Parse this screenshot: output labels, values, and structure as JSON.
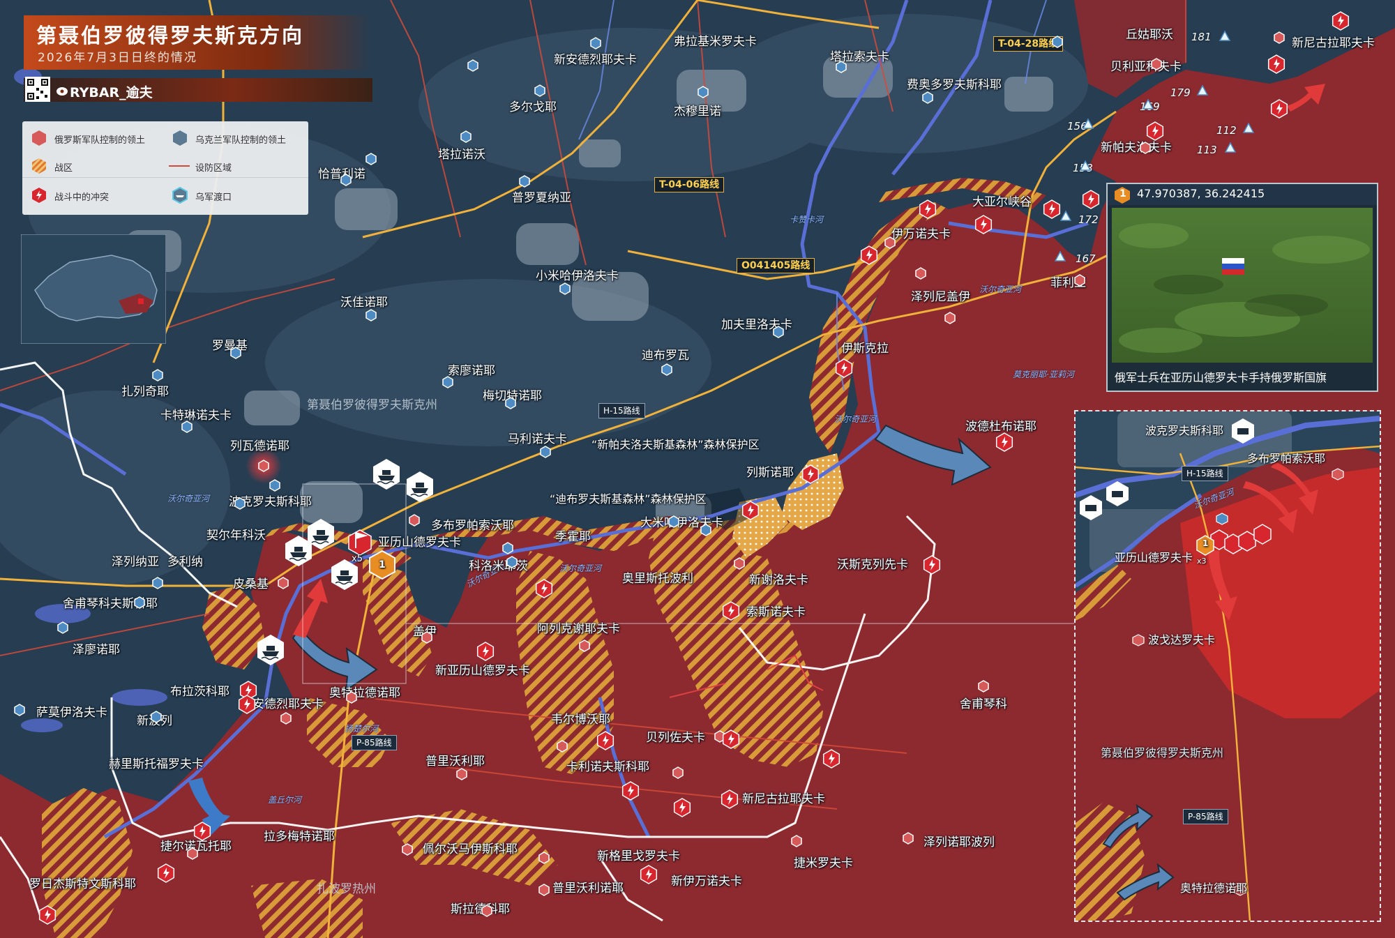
{
  "header": {
    "title": "第聂伯罗彼得罗夫斯克方向",
    "subtitle": "2026年7月3日日终的情况",
    "brand": "RYBAR_逾夫"
  },
  "legend": {
    "items": [
      {
        "label": "俄罗斯军队控制的领土",
        "icon": "russian-territory-icon"
      },
      {
        "label": "乌克兰军队控制的领土",
        "icon": "ukrainian-territory-icon"
      },
      {
        "label": "战区",
        "icon": "combat-zone-icon"
      },
      {
        "label": "设防区域",
        "icon": "fortified-line-icon"
      },
      {
        "label": "战斗中的冲突",
        "icon": "clash-icon"
      },
      {
        "label": "乌军渡口",
        "icon": "crossing-icon"
      }
    ]
  },
  "colors": {
    "russian": "#8c2a2f",
    "ukrainian": "#2a4459",
    "combat": "#d99a3a",
    "road": "#f0b23a",
    "river": "#5a6fd6",
    "accent": "#c34a1b"
  },
  "places": {
    "fulajimiluofuka": "弗拉基米罗夫卡",
    "xinandeliefu": "新安德烈耶夫卡",
    "talasuofuka": "塔拉索夫卡",
    "feiaoduoluofusikeye": "费奥多罗夫斯科耶",
    "qiuguyewo": "丘姑耶沃",
    "beiliyakefu": "贝利亚科夫卡",
    "xinnikula_top": "新尼古拉耶夫卡",
    "duoergeye": "多尔戈耶",
    "jiemuliluo": "杰穆里诺",
    "talanuowo": "塔拉诺沃",
    "xinpafuluofuka": "新帕夫洛夫卡",
    "qiapulinuo": "恰普利诺",
    "puluoxiana": "普罗夏纳亚",
    "dayaerxiagu": "大亚尔峡谷",
    "yiwannuofuka": "伊万诺夫卡",
    "feiliya": "菲利亚",
    "xiaomihayiluofuka": "小米哈伊洛夫卡",
    "zeliening": "泽列尼盖伊",
    "wojianuoye": "沃佳诺耶",
    "jiafuliluofuka": "加夫里洛夫卡",
    "yisikela": "伊斯克拉",
    "luomanji": "罗曼基",
    "dibuluowa": "迪布罗瓦",
    "suoliaonuoye": "索廖诺耶",
    "zhalieqiye": "扎列奇耶",
    "meiqietenuoye": "梅切特诺耶",
    "katelinnuofuka": "卡特琳诺夫卡",
    "liewadenuoye": "列瓦德诺耶",
    "malinuofuka": "马利诺夫卡",
    "bodedubunuoye": "波德杜布诺耶",
    "liesinuoye": "列斯诺耶",
    "bokeluofusikeye": "波克罗夫斯科耶",
    "qieernianke": "契尔年科沃",
    "duobuluopasuowoye": "多布罗帕索沃耶",
    "yalishandeluofuka": "亚历山德罗夫卡",
    "jihuoye": "季霍耶",
    "dami": "大米哈伊洛夫卡",
    "zelienaya": "泽列纳亚",
    "duolina": "多利纳",
    "keluomiliao": "科洛米耶茨",
    "aolisituobo": "奥里斯托波利",
    "xinxieluofuka": "新谢洛夫卡",
    "wosikeliexianka": "沃斯克列先卡",
    "pisangji": "皮桑基",
    "sheputinqinke": "舍甫琴科夫斯科耶",
    "suosinuofuka": "索斯诺夫卡",
    "gaiyi": "盖伊",
    "aliekexieyefuka": "阿列克谢耶夫卡",
    "zeliaonuoye": "泽廖诺耶",
    "xinyalishan": "新亚历山德罗夫卡",
    "bulabuci": "布拉茨科耶",
    "aotelade": "奥特拉德诺耶",
    "andeliefu": "安德烈耶夫卡",
    "sheputinqin": "舍甫琴科",
    "samoyiluofuka": "萨莫伊洛夫卡",
    "xinbolie": "新波列",
    "weierbowoye": "韦尔博沃耶",
    "beilieliezuofuka": "贝列佐夫卡",
    "pulishiwoliye": "普里沃利耶",
    "kalinuofu": "卡利诺夫斯科耶",
    "helisituofuluofuka": "赫里斯托福罗夫卡",
    "xinnigula_bottom": "新尼古拉耶夫卡",
    "jieernuowatuo": "捷尔诺瓦托耶",
    "ladoumiteli": "拉多梅特诺耶",
    "peiewomasi": "佩尔沃马伊斯科耶",
    "xingeliguo": "新格里戈罗夫卡",
    "jiemiluofuka": "捷米罗夫卡",
    "zeliening_bo": "泽列诺耶波列",
    "luorijieshite": "罗日杰斯特文斯科耶",
    "pulishiwolinuoye": "普里沃利诺耶",
    "xinyiwannuofuka": "新伊万诺夫卡",
    "silade": "斯拉德科耶"
  },
  "roads": {
    "t0428": "T-04-28路线",
    "t0406": "T-04-06路线",
    "o041405": "O041405路线",
    "h15": "H-15路线",
    "p85": "P-85路线"
  },
  "rivers": {
    "kazhi": "卡赞卡河",
    "woer_1": "沃尔奇亚河",
    "woer_2": "沃尔奇亚河",
    "woer_3": "沃尔奇亚河",
    "woer_4": "沃尔奇亚河",
    "woer_5": "沃尔奇亚河",
    "molinyeya": "莫克丽耶·亚莉河",
    "yangchu": "扬楚尔河",
    "gaiqiu": "盖丘尔河"
  },
  "regions": {
    "dnipro": "第聂伯罗彼得罗夫斯克州",
    "zaporozhe": "扎波罗热州",
    "forest_1": "“新帕夫洛夫斯基森林”森林保护区",
    "forest_2": "“迪布罗夫斯基森林”森林保护区"
  },
  "heights": [
    "181",
    "179",
    "169",
    "156",
    "158",
    "112",
    "113",
    "172",
    "167"
  ],
  "photo": {
    "badge": "1",
    "coords": "47.970387, 36.242415",
    "caption": "俄军士兵在亚历山德罗夫卡手持俄罗斯国旗"
  },
  "zoom": {
    "region": "第聂伯罗彼得罗夫斯克州",
    "badge": "1",
    "multiplier": "x3",
    "labels": {
      "bokeluo": "波克罗夫斯科耶",
      "duobuluo": "多布罗帕索沃耶",
      "yalishan": "亚历山德罗夫卡",
      "bogeda": "波戈达罗夫卡",
      "aotelade": "奥特拉德诺耶",
      "h15": "H-15路线",
      "woer": "沃尔奇亚河",
      "p85": "P-85路线"
    }
  },
  "markers": {
    "multiplier_main": "x5",
    "badge_main": "1"
  }
}
